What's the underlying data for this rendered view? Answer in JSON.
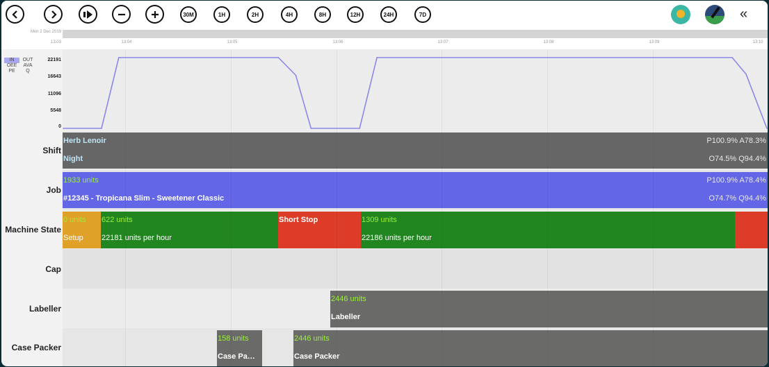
{
  "toolbar": {
    "buttons": [
      {
        "name": "back",
        "label": ""
      },
      {
        "name": "forward",
        "label": ""
      },
      {
        "name": "play",
        "label": ""
      },
      {
        "name": "zoom-out",
        "label": ""
      },
      {
        "name": "zoom-in",
        "label": ""
      },
      {
        "name": "range-30m",
        "label": "30M"
      },
      {
        "name": "range-1h",
        "label": "1H"
      },
      {
        "name": "range-2h",
        "label": "2H"
      },
      {
        "name": "range-4h",
        "label": "4H"
      },
      {
        "name": "range-8h",
        "label": "8H"
      },
      {
        "name": "range-12h",
        "label": "12H"
      },
      {
        "name": "range-24h",
        "label": "24H"
      },
      {
        "name": "range-7d",
        "label": "7D"
      }
    ],
    "collapse_label": "«"
  },
  "ruler": {
    "date": "Mon 2 Dec 2019",
    "start": "13:03",
    "ticks": [
      "13:04",
      "13:05",
      "13:06",
      "13:07",
      "13:08",
      "13:09",
      "13:10"
    ]
  },
  "legend": {
    "in": "IN",
    "out": "OUT",
    "oee": "OEE",
    "ava": "AVA",
    "pe": "PE",
    "q": "Q",
    "in_color": "#a9a6f2"
  },
  "chart_data": {
    "type": "line",
    "yticks": [
      "22191",
      "16643",
      "11096",
      "5548",
      "0"
    ],
    "ylim": [
      0,
      22191
    ],
    "x": [
      0,
      0.0543,
      0.0789,
      0.3057,
      0.3304,
      0.3521,
      0.4211,
      0.4458,
      0.9507,
      0.9704,
      1.0
    ],
    "values": [
      0,
      0,
      22191,
      22191,
      16643,
      0,
      0,
      22191,
      22191,
      17000,
      0
    ],
    "line_color": "#8a87e6"
  },
  "rows": {
    "shift": {
      "label": "Shift",
      "name_text": "Herb Lenoir",
      "period": "Night",
      "p": "P100.9%",
      "a": "A78.3%",
      "o": "O74.5%",
      "q": "Q94.4%",
      "color": "#666666"
    },
    "job": {
      "label": "Job",
      "units": "1933 units",
      "product": "#12345 - Tropicana Slim - Sweetener Classic",
      "p": "P100.9%",
      "a": "A78.4%",
      "o": "O74.7%",
      "q": "Q94.4%",
      "color": "#6366e6"
    },
    "machine_state": {
      "label": "Machine State",
      "segments": [
        {
          "units": "0 units",
          "text": "Setup",
          "color": "#e0a128"
        },
        {
          "units": "622 units",
          "text": "22181 units per hour",
          "color": "#21861f"
        },
        {
          "units": "Short Stop",
          "text": "",
          "color": "#dc3c28"
        },
        {
          "units": "1309 units",
          "text": "22186 units per hour",
          "color": "#21861f"
        },
        {
          "units": "",
          "text": "",
          "color": "#dc3c28"
        }
      ]
    },
    "cap": {
      "label": "Cap"
    },
    "labeller": {
      "label": "Labeller",
      "units": "2446 units",
      "text": "Labeller",
      "color": "#6a6a68"
    },
    "case_packer": {
      "label": "Case Packer",
      "segments": [
        {
          "units": "158 units",
          "text": "Case Pa…",
          "color": "#6a6a68"
        },
        {
          "units": "2446 units",
          "text": "Case Packer",
          "color": "#6a6a68"
        }
      ]
    }
  }
}
